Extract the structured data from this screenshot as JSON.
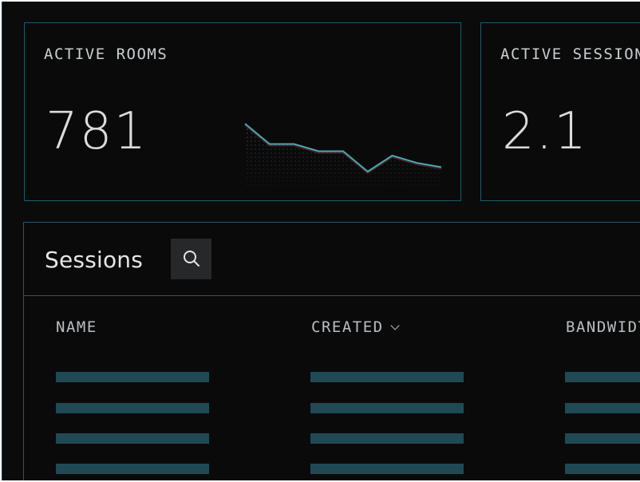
{
  "cards": [
    {
      "label": "ACTIVE ROOMS",
      "value": "781",
      "sparkline": [
        100,
        86,
        86,
        81,
        81,
        67,
        78,
        73,
        70
      ]
    },
    {
      "label": "ACTIVE SESSIONS",
      "value": "2.1"
    }
  ],
  "sessions": {
    "title": "Sessions",
    "columns": [
      {
        "label": "NAME"
      },
      {
        "label": "CREATED",
        "sort_icon": "chevron-down-icon"
      },
      {
        "label": "BANDWIDTH"
      }
    ],
    "row_count": 4
  },
  "icons": {
    "search": "search-icon"
  },
  "colors": {
    "background": "#0b0b0c",
    "border": "#1f5b66",
    "sparkline": "#4aa8b8",
    "placeholder": "#1f4a54"
  }
}
